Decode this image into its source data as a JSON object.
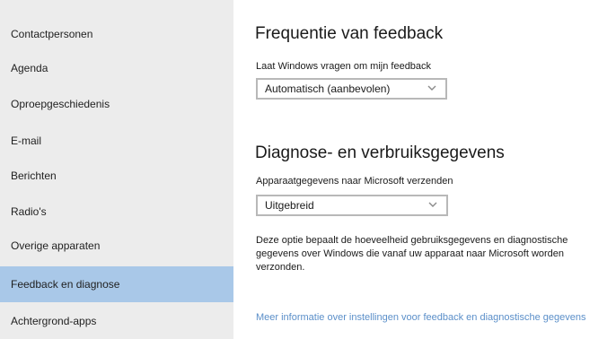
{
  "sidebar": {
    "items": [
      {
        "label": "Contactpersonen"
      },
      {
        "label": "Agenda"
      },
      {
        "label": "Oproepgeschiedenis"
      },
      {
        "label": "E-mail"
      },
      {
        "label": "Berichten"
      },
      {
        "label": "Radio's"
      },
      {
        "label": "Overige apparaten"
      },
      {
        "label": "Feedback en diagnose",
        "selected": true
      },
      {
        "label": "Achtergrond-apps"
      }
    ]
  },
  "feedback_frequency": {
    "title": "Frequentie van feedback",
    "label": "Laat Windows vragen om mijn feedback",
    "selected_value": "Automatisch (aanbevolen)"
  },
  "diagnostics": {
    "title": "Diagnose- en verbruiksgegevens",
    "label": "Apparaatgegevens naar Microsoft verzenden",
    "selected_value": "Uitgebreid",
    "description": "Deze optie bepaalt de hoeveelheid gebruiksgegevens en diagnostische gegevens over Windows die vanaf uw apparaat naar Microsoft worden verzonden.",
    "link_text": "Meer informatie over instellingen voor feedback en diagnostische gegevens"
  },
  "colors": {
    "sidebar_bg": "#ececec",
    "selected_bg": "#a9c8e8",
    "link": "#5b8fc9"
  }
}
